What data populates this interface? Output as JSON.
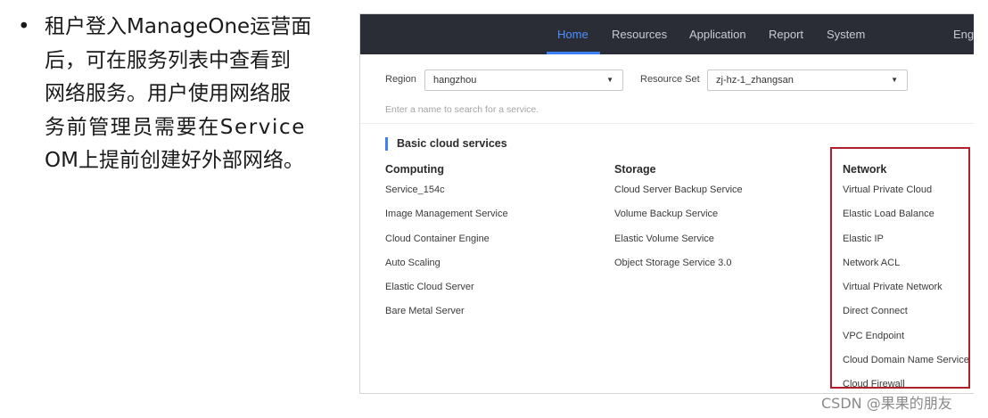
{
  "slide": {
    "bullet": "•",
    "lines": [
      "租户登入ManageOne运营面",
      "后，可在服务列表中查看到",
      "网络服务。用户使用网络服",
      "务前管理员需要在Service",
      "OM上提前创建好外部网络。"
    ]
  },
  "nav": {
    "items": [
      "Home",
      "Resources",
      "Application",
      "Report",
      "System",
      "Engl"
    ],
    "active": "Home"
  },
  "filters": {
    "region_label": "Region",
    "region_value": "hangzhou",
    "resource_set_label": "Resource Set",
    "resource_set_value": "zj-hz-1_zhangsan",
    "caret": "▼"
  },
  "search": {
    "placeholder": "Enter a name to search for a service."
  },
  "section": {
    "title": "Basic cloud services"
  },
  "columns": [
    {
      "title": "Computing",
      "items": [
        "Service_154c",
        "Image Management Service",
        "Cloud Container Engine",
        "Auto Scaling",
        "Elastic Cloud Server",
        "Bare Metal Server"
      ]
    },
    {
      "title": "Storage",
      "items": [
        "Cloud Server Backup Service",
        "Volume Backup Service",
        "Elastic Volume Service",
        "Object Storage Service 3.0"
      ]
    },
    {
      "title": "Network",
      "items": [
        "Virtual Private Cloud",
        "Elastic Load Balance",
        "Elastic IP",
        "Network ACL",
        "Virtual Private Network",
        "Direct Connect",
        "VPC Endpoint",
        "Cloud Domain Name Service",
        "Cloud Firewall"
      ]
    }
  ],
  "highlight_color": "#b0202a",
  "accent_color": "#3d7ff5",
  "watermark": "CSDN @果果的朋友"
}
